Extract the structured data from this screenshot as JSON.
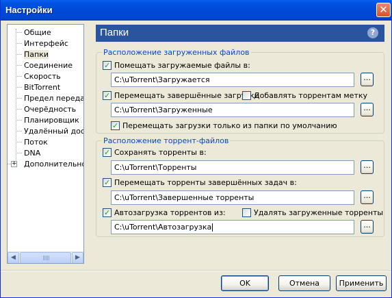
{
  "window": {
    "title": "Настройки",
    "close_symbol": "✕"
  },
  "tree": {
    "items": [
      "Общие",
      "Интерфейс",
      "Папки",
      "Соединение",
      "Скорость",
      "BitTorrent",
      "Предел передачи",
      "Очерёдность",
      "Планировщик",
      "Удалённый доступ",
      "Поток",
      "DNA",
      "Дополнительно"
    ],
    "selected": "Папки",
    "expander_symbol": "+",
    "scroll_left": "◀",
    "scroll_right": "▶"
  },
  "header": {
    "title": "Папки",
    "help_symbol": "?"
  },
  "downloads_group": {
    "label": "Расположение загруженных файлов",
    "put_new_label": "Помещать загружаемые файлы в:",
    "put_new_path": "C:\\uTorrent\\Загружается",
    "move_completed_label": "Перемещать завершённые загрузки",
    "append_label_label": "Добавлять торрентам метку",
    "move_completed_path": "C:\\uTorrent\\Загруженные",
    "only_default_label": "Перемещать загрузки только из папки по умолчанию",
    "browse_label": "..."
  },
  "torrents_group": {
    "label": "Расположение торрент-файлов",
    "store_label": "Сохранять торренты в:",
    "store_path": "C:\\uTorrent\\Торренты",
    "move_finished_label": "Перемещать торренты завершённых задач в:",
    "move_finished_path": "C:\\uTorrent\\Завершенные торренты",
    "autoload_label": "Автозагрузка торрентов из:",
    "delete_loaded_label": "Удалять загруженные торренты",
    "autoload_path": "C:\\uTorrent\\Автозагрузка",
    "browse_label": "..."
  },
  "buttons": {
    "ok": "OK",
    "cancel": "Отмена",
    "apply": "Применить"
  }
}
